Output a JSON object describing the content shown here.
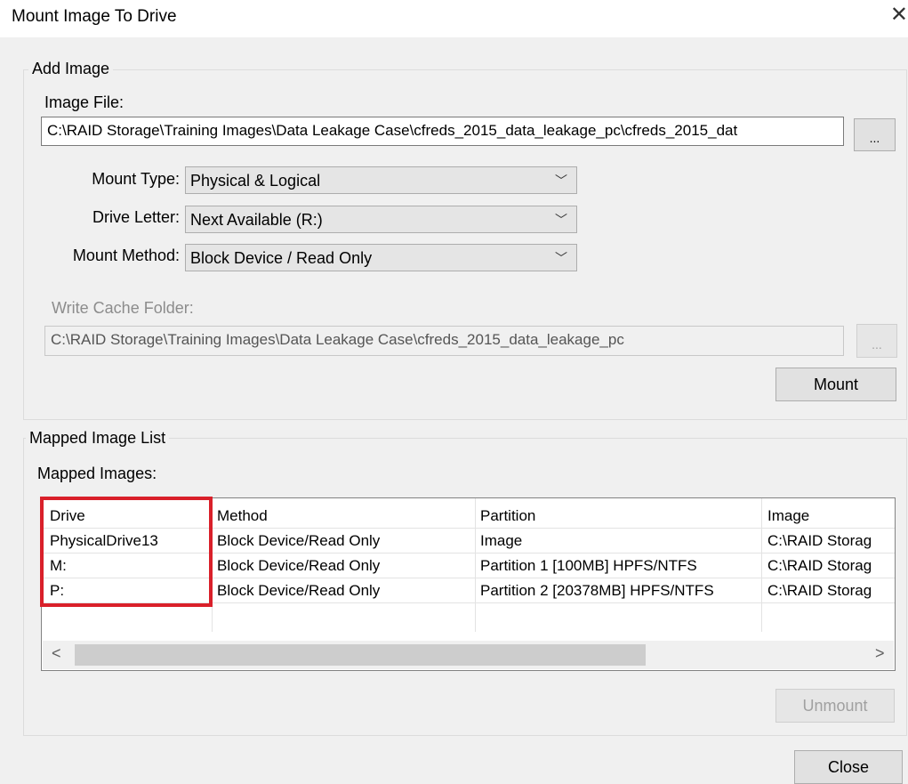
{
  "window": {
    "title": "Mount Image To Drive"
  },
  "add_image": {
    "legend": "Add Image",
    "image_file_label": "Image File:",
    "image_file_value": "C:\\RAID Storage\\Training Images\\Data Leakage Case\\cfreds_2015_data_leakage_pc\\cfreds_2015_dat",
    "browse_label": "...",
    "mount_type_label": "Mount Type:",
    "mount_type_value": "Physical & Logical",
    "drive_letter_label": "Drive Letter:",
    "drive_letter_value": "Next Available (R:)",
    "mount_method_label": "Mount Method:",
    "mount_method_value": "Block Device / Read Only",
    "write_cache_label": "Write Cache Folder:",
    "write_cache_value": "C:\\RAID Storage\\Training Images\\Data Leakage Case\\cfreds_2015_data_leakage_pc",
    "cache_browse_label": "...",
    "mount_button": "Mount"
  },
  "mapped": {
    "legend": "Mapped Image List",
    "list_label": "Mapped Images:",
    "columns": [
      "Drive",
      "Method",
      "Partition",
      "Image"
    ],
    "rows": [
      [
        "PhysicalDrive13",
        "Block Device/Read Only",
        "Image",
        "C:\\RAID Storag"
      ],
      [
        "M:",
        "Block Device/Read Only",
        "Partition 1 [100MB] HPFS/NTFS",
        "C:\\RAID Storag"
      ],
      [
        "P:",
        "Block Device/Read Only",
        "Partition 2 [20378MB] HPFS/NTFS",
        "C:\\RAID Storag"
      ]
    ],
    "scroll_left": "<",
    "scroll_right": ">",
    "unmount_button": "Unmount"
  },
  "footer": {
    "close_button": "Close"
  },
  "icons": {
    "close": "close-icon",
    "dropdown": "chevron-down-icon"
  },
  "colors": {
    "highlight": "#d9202a"
  }
}
